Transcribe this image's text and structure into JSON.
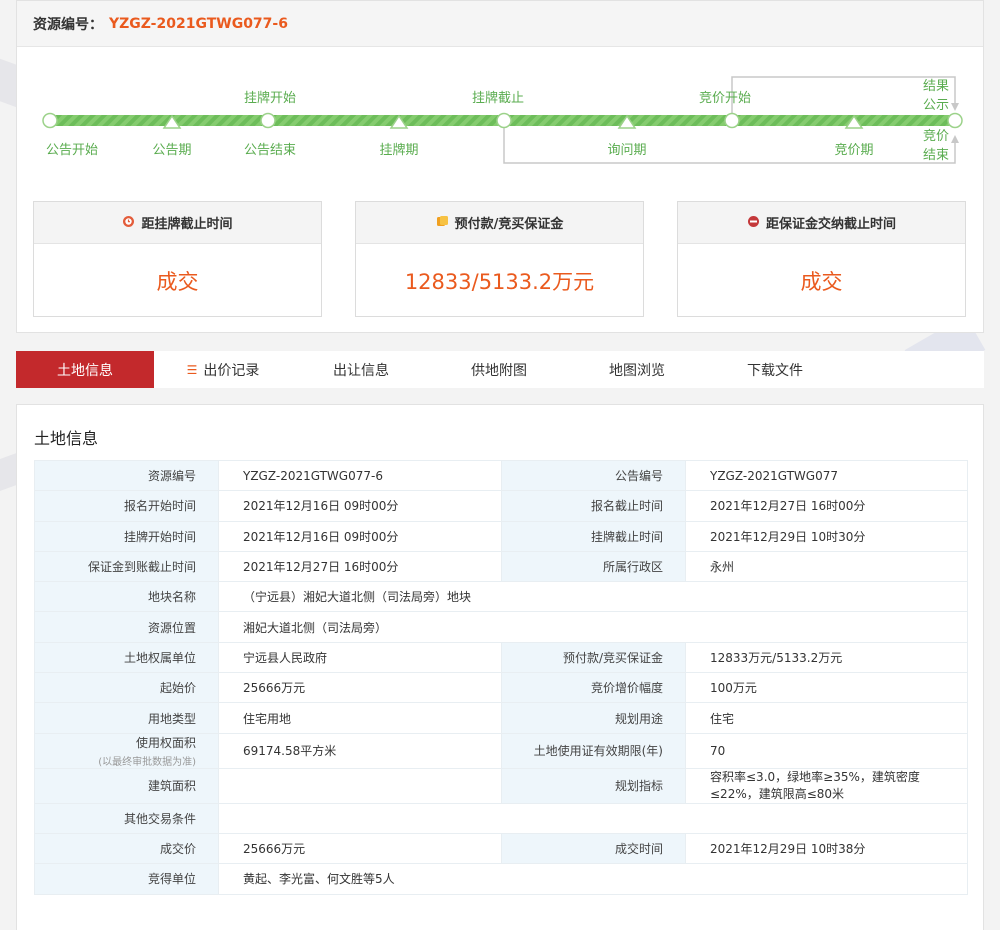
{
  "resource": {
    "label": "资源编号：",
    "value": "YZGZ-2021GTWG077-6"
  },
  "timeline": {
    "top_labels": [
      "挂牌开始",
      "挂牌截止",
      "竞价开始"
    ],
    "bottom_labels": [
      "公告开始",
      "公告期",
      "公告结束",
      "挂牌期",
      "询问期",
      "竞价期"
    ],
    "right_top": [
      "结果",
      "公示"
    ],
    "right_bottom": [
      "竞价",
      "结束"
    ]
  },
  "boxes": [
    {
      "title": "距挂牌截止时间",
      "value": "成交",
      "icon": "clock-icon"
    },
    {
      "title": "预付款/竞买保证金",
      "value": "12833/5133.2万元",
      "icon": "coins-icon"
    },
    {
      "title": "距保证金交纳截止时间",
      "value": "成交",
      "icon": "clock-icon"
    }
  ],
  "tabs": [
    "土地信息",
    "出价记录",
    "出让信息",
    "供地附图",
    "地图浏览",
    "下载文件"
  ],
  "land": {
    "title": "土地信息",
    "rows": [
      {
        "k1": "资源编号",
        "v1": "YZGZ-2021GTWG077-6",
        "k2": "公告编号",
        "v2": "YZGZ-2021GTWG077"
      },
      {
        "k1": "报名开始时间",
        "v1": "2021年12月16日 09时00分",
        "k2": "报名截止时间",
        "v2": "2021年12月27日 16时00分"
      },
      {
        "k1": "挂牌开始时间",
        "v1": "2021年12月16日 09时00分",
        "k2": "挂牌截止时间",
        "v2": "2021年12月29日 10时30分"
      },
      {
        "k1": "保证金到账截止时间",
        "v1": "2021年12月27日 16时00分",
        "k2": "所属行政区",
        "v2": "永州"
      },
      {
        "k1": "地块名称",
        "v1": "（宁远县）湘妃大道北侧（司法局旁）地块"
      },
      {
        "k1": "资源位置",
        "v1": "湘妃大道北侧（司法局旁）"
      },
      {
        "k1": "土地权属单位",
        "v1": "宁远县人民政府",
        "k2": "预付款/竞买保证金",
        "v2": "12833万元/5133.2万元"
      },
      {
        "k1": "起始价",
        "v1": "25666万元",
        "k2": "竞价增价幅度",
        "v2": "100万元"
      },
      {
        "k1": "用地类型",
        "v1": "住宅用地",
        "k2": "规划用途",
        "v2": "住宅"
      },
      {
        "k1": "使用权面积",
        "k1_sub": "(以最终审批数据为准)",
        "v1": "69174.58平方米",
        "k2": "土地使用证有效期限(年)",
        "v2": "70"
      },
      {
        "k1": "建筑面积",
        "v1": "",
        "k2": "规划指标",
        "v2": "容积率≤3.0，绿地率≥35%，建筑密度≤22%，建筑限高≤80米"
      },
      {
        "k1": "其他交易条件",
        "v1": ""
      },
      {
        "k1": "成交价",
        "v1": "25666万元",
        "k2": "成交时间",
        "v2": "2021年12月29日 10时38分"
      },
      {
        "k1": "竞得单位",
        "v1": "黄起、李光富、何文胜等5人"
      }
    ]
  },
  "colors": {
    "accent": "#ea5a1e",
    "tab_active": "#c3292c",
    "timeline_green": "#5aac4f"
  }
}
